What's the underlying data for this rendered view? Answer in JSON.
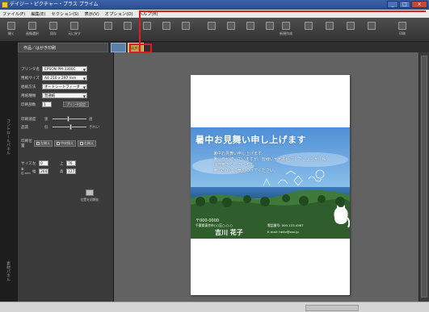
{
  "window": {
    "title": "デイジー・ピクチャー・プラス プライム",
    "buttons": [
      "_",
      "□",
      "×"
    ]
  },
  "menu": [
    {
      "label": "ファイル(F)"
    },
    {
      "label": "編集(E)"
    },
    {
      "label": "セクション(S)"
    },
    {
      "label": "表示(V)"
    },
    {
      "label": "オプション(O)"
    },
    {
      "label": "ヘルプ(H)"
    }
  ],
  "toolbar": [
    {
      "label": "開く",
      "icon": "folder-icon"
    },
    {
      "label": "画像選択",
      "icon": "image-icon"
    },
    {
      "label": "保存",
      "icon": "save-icon"
    },
    {
      "label": "元に戻す",
      "icon": "undo-icon"
    },
    {
      "label": "",
      "icon": "scissors-icon"
    },
    {
      "label": "",
      "icon": "copy-icon"
    },
    {
      "label": "",
      "icon": "paste-icon"
    },
    {
      "label": "",
      "icon": "redo-icon"
    },
    {
      "label": "",
      "icon": "layer-icon"
    },
    {
      "label": "",
      "icon": "rotate-icon"
    },
    {
      "label": "",
      "icon": "text-icon"
    },
    {
      "label": "",
      "icon": "frame-icon"
    },
    {
      "label": "",
      "icon": "stamp-icon"
    },
    {
      "label": "新規作成",
      "icon": "new-icon"
    },
    {
      "label": "",
      "icon": "ruler-icon"
    },
    {
      "label": "",
      "icon": "zoom-icon"
    },
    {
      "label": "",
      "icon": "grid-icon"
    },
    {
      "label": "",
      "icon": "settings-icon"
    },
    {
      "label": "印刷",
      "icon": "print-icon"
    }
  ],
  "panel_tab": "作品／はがき印刷",
  "doc_tab_b": "はがき",
  "side_labels": {
    "left": "コントロールパネル",
    "bottom": "素材パネル"
  },
  "print_settings": {
    "printer_label": "プリンタ名",
    "printer_value": "EPSON PM-3300C",
    "paper_label": "用紙サイズ",
    "paper_value": "A4 210 x 297 mm",
    "feed_label": "給紙方法",
    "feed_value": "オートシートフィーダ",
    "type_label": "用紙種類",
    "type_value": "普通紙",
    "copies_label": "印刷部数",
    "copies_value": "1",
    "printer_setup_button": "プリンタ設定"
  },
  "quality": {
    "speed_label": "印刷速度",
    "speed_left": "速",
    "speed_right": "遅",
    "speed_value": 0.45,
    "quality_label": "品質",
    "quality_left": "低",
    "quality_right": "きれい",
    "quality_value": 0.55
  },
  "alignment": {
    "label": "印刷位置",
    "buttons": [
      "左揃え",
      "中央揃え",
      "右揃え"
    ]
  },
  "size": {
    "label": "サイズ",
    "unit_label": "単位:mm",
    "left_label": "左",
    "left_value": "0",
    "top_label": "上",
    "top_value": "76",
    "width_label": "幅",
    "width_value": "264",
    "height_label": "高",
    "height_value": "127",
    "reset_button": "位置を初期化"
  },
  "card": {
    "title": "暑中お見舞い申し上げます",
    "message_1": "暑中お見舞い申し上げます。",
    "message_2": "暑い日が続いていますが、皆様いかがお過ごしでしょうか。私は元気でやっています。",
    "message_3": "暑いので体に気をつけてください。",
    "zip": "〒000-0000",
    "address": "千葉県東京市○○区○-○-○",
    "name": "吉川 花子",
    "tel": "電話番号: 000-123-4567",
    "email": "E-mail: hello@xxx.jp"
  },
  "colors": {
    "annotation": "#d92020",
    "accent_tab": "#c9a04a"
  }
}
